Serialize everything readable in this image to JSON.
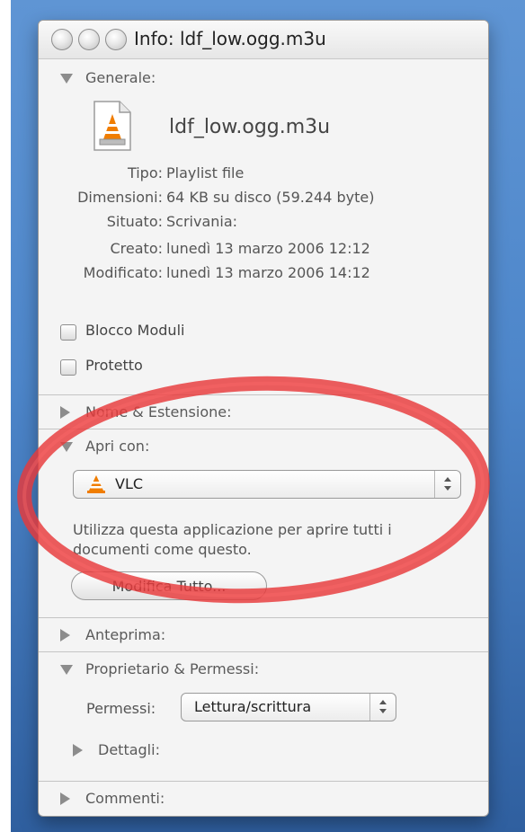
{
  "window": {
    "title": "Info: ldf_low.ogg.m3u"
  },
  "general": {
    "label": "Generale:",
    "file_name": "ldf_low.ogg.m3u",
    "rows": [
      {
        "key": "Tipo:",
        "value": "Playlist file"
      },
      {
        "key": "Dimensioni:",
        "value": "64 KB su disco (59.244 byte)"
      },
      {
        "key": "Situato:",
        "value": "Scrivania:"
      },
      {
        "key": "Creato:",
        "value": "lunedì 13 marzo 2006 12:12"
      },
      {
        "key": "Modificato:",
        "value": "lunedì 13 marzo 2006 14:12"
      }
    ],
    "checkboxes": [
      {
        "label": "Blocco Moduli",
        "checked": false
      },
      {
        "label": "Protetto",
        "checked": false
      }
    ]
  },
  "name_extension": {
    "label": "Nome & Estensione:"
  },
  "open_with": {
    "label": "Apri con:",
    "selected_app": "VLC",
    "description": "Utilizza questa applicazione per aprire tutti i documenti come questo.",
    "change_all_label": "Modifica Tutto..."
  },
  "preview": {
    "label": "Anteprima:"
  },
  "ownership": {
    "label": "Proprietario & Permessi:",
    "permissions_label": "Permessi:",
    "permissions_value": "Lettura/scrittura",
    "details_label": "Dettagli:"
  },
  "comments": {
    "label": "Commenti:"
  },
  "colors": {
    "highlight_ring": "#e8393a",
    "vlc_orange": "#f07d00"
  }
}
